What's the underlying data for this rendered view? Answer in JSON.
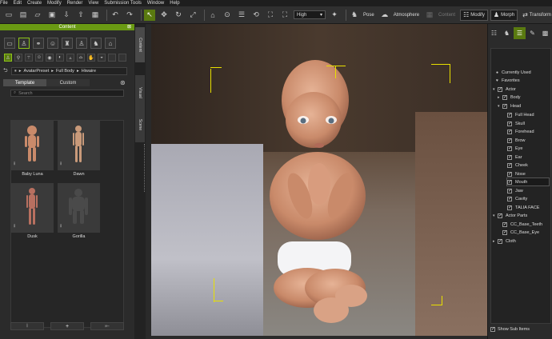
{
  "menu": [
    "File",
    "Edit",
    "Create",
    "Modify",
    "Render",
    "View",
    "Submission Tools",
    "Window",
    "Help"
  ],
  "toolbar": {
    "quality_value": "High",
    "pose_label": "Pose",
    "atmosphere_label": "Atmosphere",
    "content_label": "Content",
    "modify_label": "Modify",
    "morph_label": "Morph",
    "transform_label": "Transform"
  },
  "left_panel": {
    "title": "Content",
    "breadcrumb": [
      "AvatarPreset",
      "Full Body",
      "Hiwaire"
    ],
    "tabs": [
      "Template",
      "Custom"
    ],
    "search_placeholder": "Search",
    "items": [
      {
        "label": "Baby Luna",
        "tone": "#c98a6a"
      },
      {
        "label": "Dawn",
        "tone": "#c99a7a"
      },
      {
        "label": "Dusk",
        "tone": "#b87060"
      },
      {
        "label": "Gorilla",
        "tone": "#4a4a4a"
      }
    ]
  },
  "side_tabs": [
    "Content",
    "Visual",
    "Scene"
  ],
  "scene_tree": {
    "items": [
      {
        "label": "Currently Used",
        "icon": "dot"
      },
      {
        "label": "Favorites",
        "icon": "heart"
      },
      {
        "label": "Actor"
      },
      {
        "label": "Body"
      },
      {
        "label": "Head"
      },
      {
        "label": "Full Head"
      },
      {
        "label": "Skull"
      },
      {
        "label": "Forehead"
      },
      {
        "label": "Brow"
      },
      {
        "label": "Eye"
      },
      {
        "label": "Ear"
      },
      {
        "label": "Cheek"
      },
      {
        "label": "Nose"
      },
      {
        "label": "Mouth"
      },
      {
        "label": "Jaw"
      },
      {
        "label": "Cavity"
      },
      {
        "label": "TALIA FACE"
      },
      {
        "label": "Actor Parts"
      },
      {
        "label": "CC_Base_Teeth"
      },
      {
        "label": "CC_Base_Eye"
      },
      {
        "label": "Cloth"
      }
    ],
    "show_sub_items": "Show Sub Items"
  },
  "colors": {
    "accent": "#6a9a13",
    "bbox": "#e8e000"
  }
}
